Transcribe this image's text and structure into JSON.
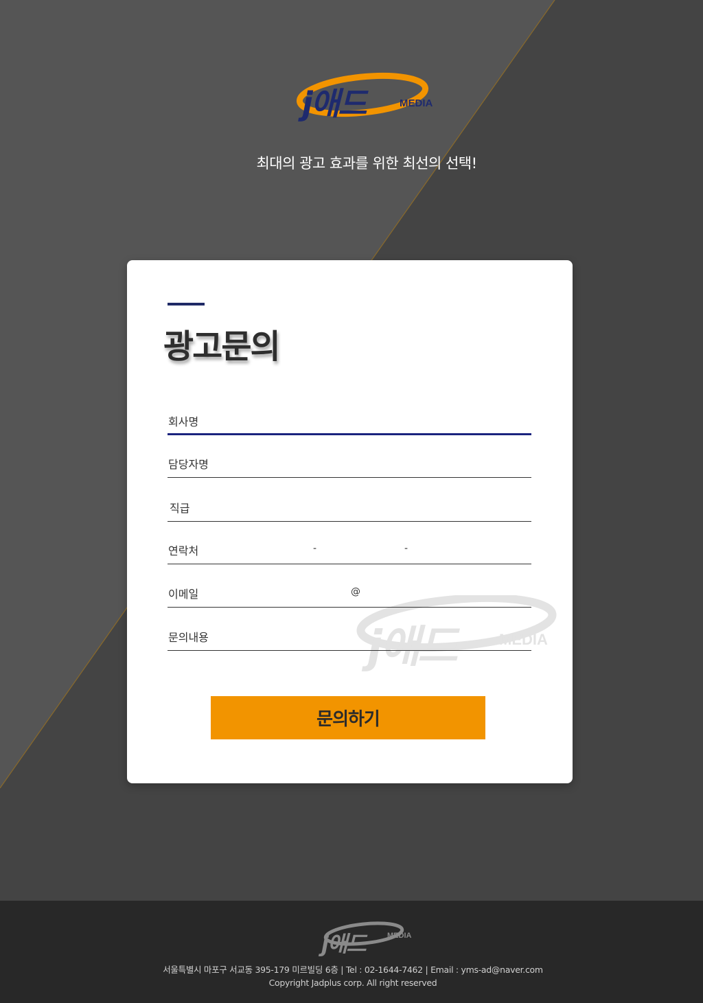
{
  "colors": {
    "background": "#444444",
    "background_light": "#555555",
    "diagonal_line": "#8a6a2a",
    "card": "#ffffff",
    "brand_navy": "#1e2a6e",
    "brand_orange": "#f29400",
    "footer": "#282828"
  },
  "header": {
    "logo_text": "j애드",
    "logo_sub": "MEDIA",
    "tagline": "최대의 광고 효과를 위한 최선의 선택!"
  },
  "form": {
    "title": "광고문의",
    "fields": {
      "company": {
        "label": "회사명"
      },
      "manager": {
        "label": "담당자명"
      },
      "position": {
        "label": "직급"
      },
      "contact": {
        "label": "연락처",
        "separator": "-"
      },
      "email": {
        "label": "이메일",
        "separator": "@"
      },
      "inquiry": {
        "label": "문의내용"
      }
    },
    "submit_label": "문의하기",
    "watermark_text": "j애드",
    "watermark_sub": "MEDIA"
  },
  "footer": {
    "logo_text": "j애드",
    "logo_sub": "MEDIA",
    "address": "서울특별시 마포구 서교동 395-179 미르빌딩 6층 | Tel : 02-1644-7462 | Email : yms-ad@naver.com",
    "copyright": "Copyright Jadplus corp. All right reserved"
  }
}
